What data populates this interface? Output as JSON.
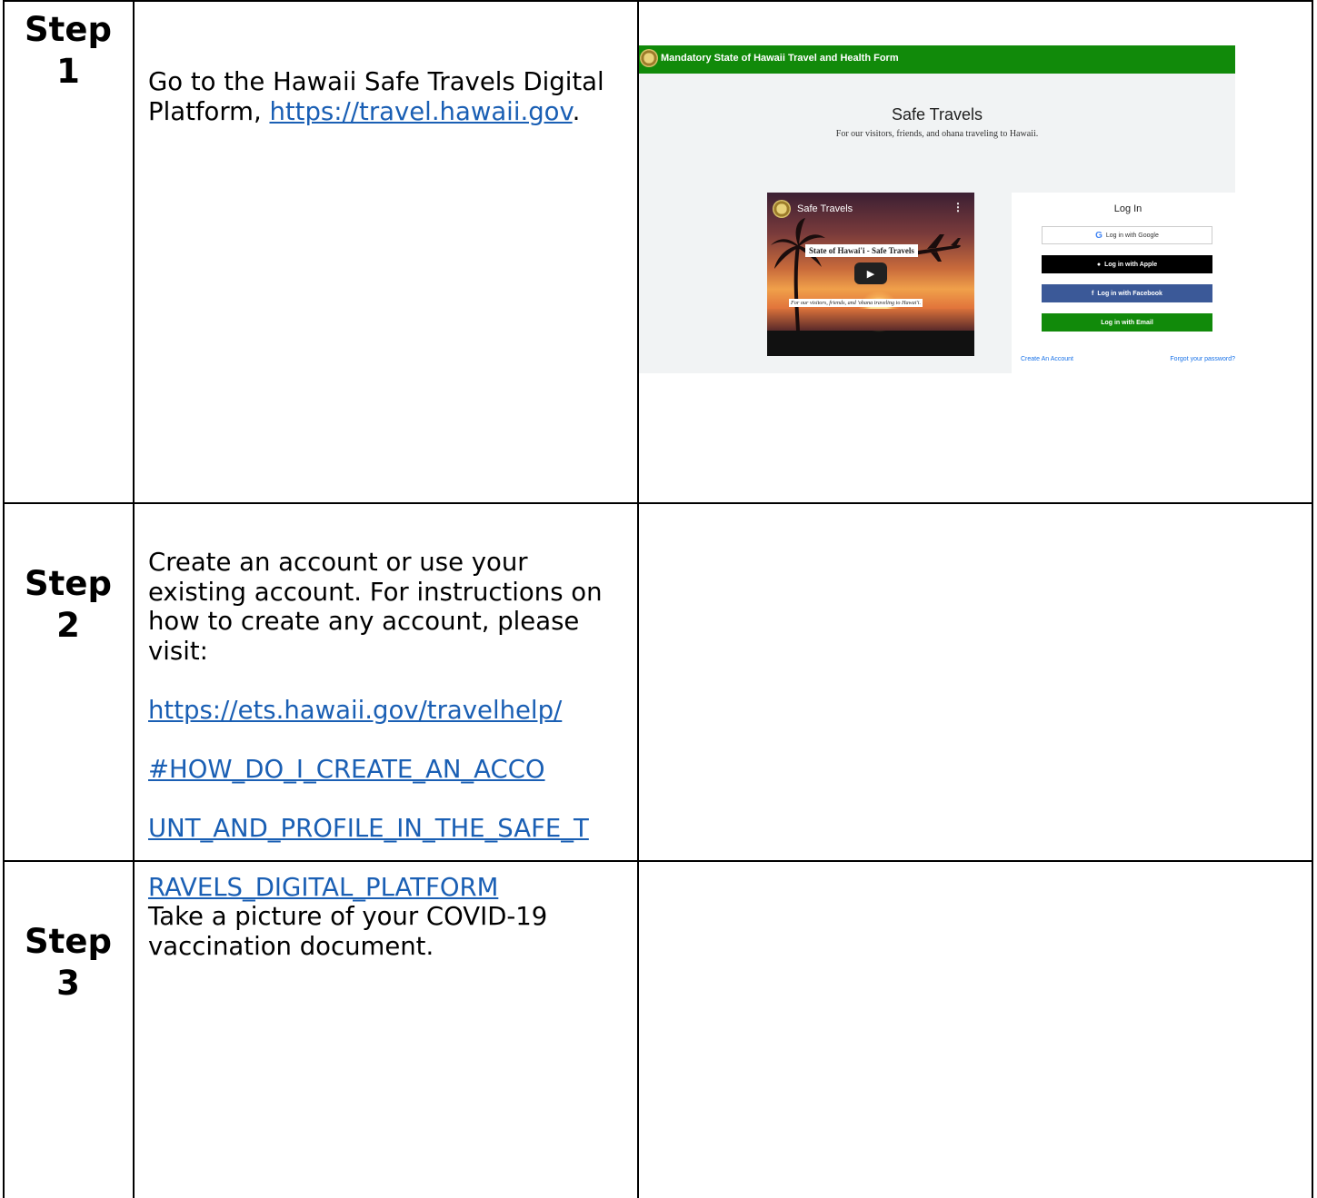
{
  "steps": [
    {
      "label": "Step\n1",
      "text_before": "Go to the Hawaii Safe Travels Digital Platform, ",
      "link": "https://travel.hawaii.gov",
      "text_after": "."
    },
    {
      "label": "Step\n2",
      "text": "Create an account or use your existing account.  For instructions on how to create any account, please visit:",
      "link_lines": [
        "https://ets.hawaii.gov/travelhelp/",
        "#HOW_DO_I_CREATE_AN_ACCO",
        "UNT_AND_PROFILE_IN_THE_SAFE_T",
        "RAVELS_DIGITAL_PLATFORM"
      ]
    },
    {
      "label": "Step\n3",
      "text": "Take a picture of your COVID-19 vaccination document."
    }
  ],
  "screenshot": {
    "header_title": "Mandatory State of Hawaii Travel and Health Form",
    "heading": "Safe Travels",
    "subheading": "For our visitors, friends, and ohana traveling to Hawaii.",
    "video": {
      "channel": "Safe Travels",
      "menu": "⋮",
      "banner": "State of Hawai'i - Safe Travels",
      "caption": "For our visitors, friends, and 'ohana traveling to Hawai'i.",
      "play": "▶"
    },
    "login": {
      "title": "Log In",
      "google": "Log in with Google",
      "apple": "Log in with Apple",
      "facebook": "Log in with Facebook",
      "email": "Log in with Email",
      "create_account": "Create An Account",
      "forgot_password": "Forgot your password?"
    },
    "colors": {
      "header": "#118a0a",
      "facebook": "#3b5998",
      "email": "#118a0a",
      "link": "#1a73e8"
    }
  }
}
